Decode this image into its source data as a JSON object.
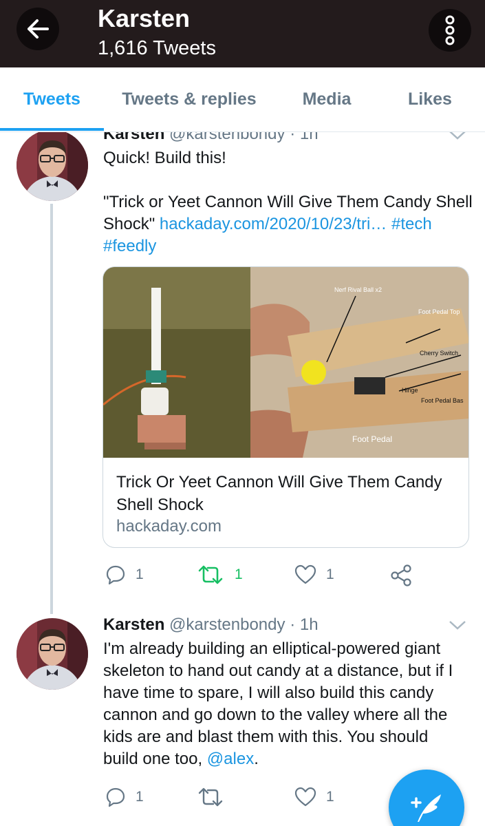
{
  "header": {
    "title": "Karsten",
    "subtitle": "1,616 Tweets",
    "back_icon": "arrow-left-icon",
    "more_icon": "more-vertical-icon"
  },
  "tabs": [
    {
      "label": "Tweets",
      "active": true
    },
    {
      "label": "Tweets & replies",
      "active": false
    },
    {
      "label": "Media",
      "active": false
    },
    {
      "label": "Likes",
      "active": false
    }
  ],
  "tweets": [
    {
      "name": "Karsten",
      "handle": "@karstenbondy",
      "time": "1h",
      "text_line1": "Quick! Build this!",
      "text_quote": "\"Trick or Yeet Cannon Will Give Them Candy Shell Shock\" ",
      "link": "hackaday.com/2020/10/23/tri…",
      "hashtag1": "#tech",
      "hashtag2": "#feedly",
      "card": {
        "image_labels": {
          "nerf": "Nerf Rival Ball x2",
          "pedal_top": "Foot Pedal Top",
          "cherry": "Cherry Switch",
          "hinge": "Hinge",
          "pedal_base": "Foot Pedal Bas",
          "foot_pedal": "Foot Pedal"
        },
        "title": "Trick Or Yeet Cannon Will Give Them Candy Shell Shock",
        "domain": "hackaday.com"
      },
      "replies": "1",
      "retweets": "1",
      "likes": "1",
      "retweeted": true
    },
    {
      "name": "Karsten",
      "handle": "@karstenbondy",
      "time": "1h",
      "text": "I'm already building an elliptical-powered giant skeleton to hand out candy at a distance, but if I have time to spare, I will also build this candy cannon and go down to the valley where all the kids are and blast them with this. You should build one too, ",
      "mention": "@alex",
      "text_end": ".",
      "replies": "1",
      "retweets": "",
      "likes": "1",
      "retweeted": false
    }
  ],
  "fab": {
    "icon": "compose-tweet-icon"
  },
  "colors": {
    "accent": "#1da1f2",
    "header_bg": "#231b1c",
    "retweet_green": "#17bf63",
    "muted": "#657786"
  }
}
